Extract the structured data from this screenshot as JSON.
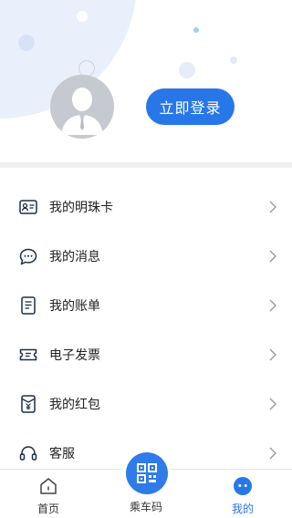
{
  "header": {
    "login_button": "立即登录"
  },
  "menu": {
    "items": [
      {
        "label": "我的明珠卡",
        "icon": "id-card-icon"
      },
      {
        "label": "我的消息",
        "icon": "chat-bubble-icon"
      },
      {
        "label": "我的账单",
        "icon": "bill-icon"
      },
      {
        "label": "电子发票",
        "icon": "ticket-icon"
      },
      {
        "label": "我的红包",
        "icon": "red-packet-icon"
      },
      {
        "label": "客服",
        "icon": "headset-icon"
      }
    ]
  },
  "tabbar": {
    "home": "首页",
    "code": "乘车码",
    "me": "我的"
  },
  "colors": {
    "accent": "#2877e8",
    "icon": "#1f2d4a"
  }
}
